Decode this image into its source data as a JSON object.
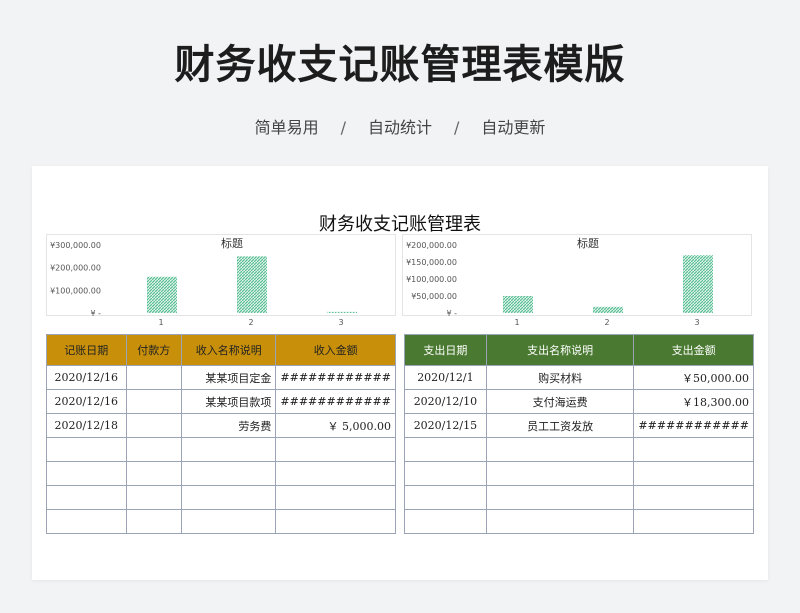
{
  "header": {
    "title": "财务收支记账管理表模版",
    "tags": [
      "简单易用",
      "自动统计",
      "自动更新"
    ],
    "separator": "/"
  },
  "sheet": {
    "title": "财务收支记账管理表"
  },
  "income_chart_data": {
    "type": "bar",
    "title": "标题",
    "categories": [
      "1",
      "2",
      "3"
    ],
    "values": [
      160000,
      250000,
      5000
    ],
    "ylim": [
      0,
      300000
    ],
    "ytick_labels": [
      "¥ -",
      "¥100,000.00",
      "¥200,000.00",
      "¥300,000.00"
    ],
    "ytick_values": [
      0,
      100000,
      200000,
      300000
    ],
    "bar_color": "#5bbf95"
  },
  "expense_chart_data": {
    "type": "bar",
    "title": "标题",
    "categories": [
      "1",
      "2",
      "3"
    ],
    "values": [
      50000,
      18300,
      170000
    ],
    "ylim": [
      0,
      200000
    ],
    "ytick_labels": [
      "¥ -",
      "¥50,000.00",
      "¥100,000.00",
      "¥150,000.00",
      "¥200,000.00"
    ],
    "ytick_values": [
      0,
      50000,
      100000,
      150000,
      200000
    ],
    "bar_color": "#5bbf95"
  },
  "income_table": {
    "headers": [
      "记账日期",
      "付款方",
      "收入名称说明",
      "收入金额"
    ],
    "rows": [
      [
        "2020/12/16",
        "",
        "某某项目定金",
        "############"
      ],
      [
        "2020/12/16",
        "",
        "某某项目款项",
        "############"
      ],
      [
        "2020/12/18",
        "",
        "劳务费",
        "￥  5,000.00"
      ],
      [
        "",
        "",
        "",
        ""
      ],
      [
        "",
        "",
        "",
        ""
      ],
      [
        "",
        "",
        "",
        ""
      ],
      [
        "",
        "",
        "",
        ""
      ]
    ],
    "header_color": "#c8900a"
  },
  "expense_table": {
    "headers": [
      "支出日期",
      "支出名称说明",
      "支出金额"
    ],
    "rows": [
      [
        "2020/12/1",
        "购买材料",
        "￥50,000.00"
      ],
      [
        "2020/12/10",
        "支付海运费",
        "￥18,300.00"
      ],
      [
        "2020/12/15",
        "员工工资发放",
        "############"
      ],
      [
        "",
        "",
        ""
      ],
      [
        "",
        "",
        ""
      ],
      [
        "",
        "",
        ""
      ],
      [
        "",
        "",
        ""
      ]
    ],
    "header_color": "#4a7a31"
  }
}
